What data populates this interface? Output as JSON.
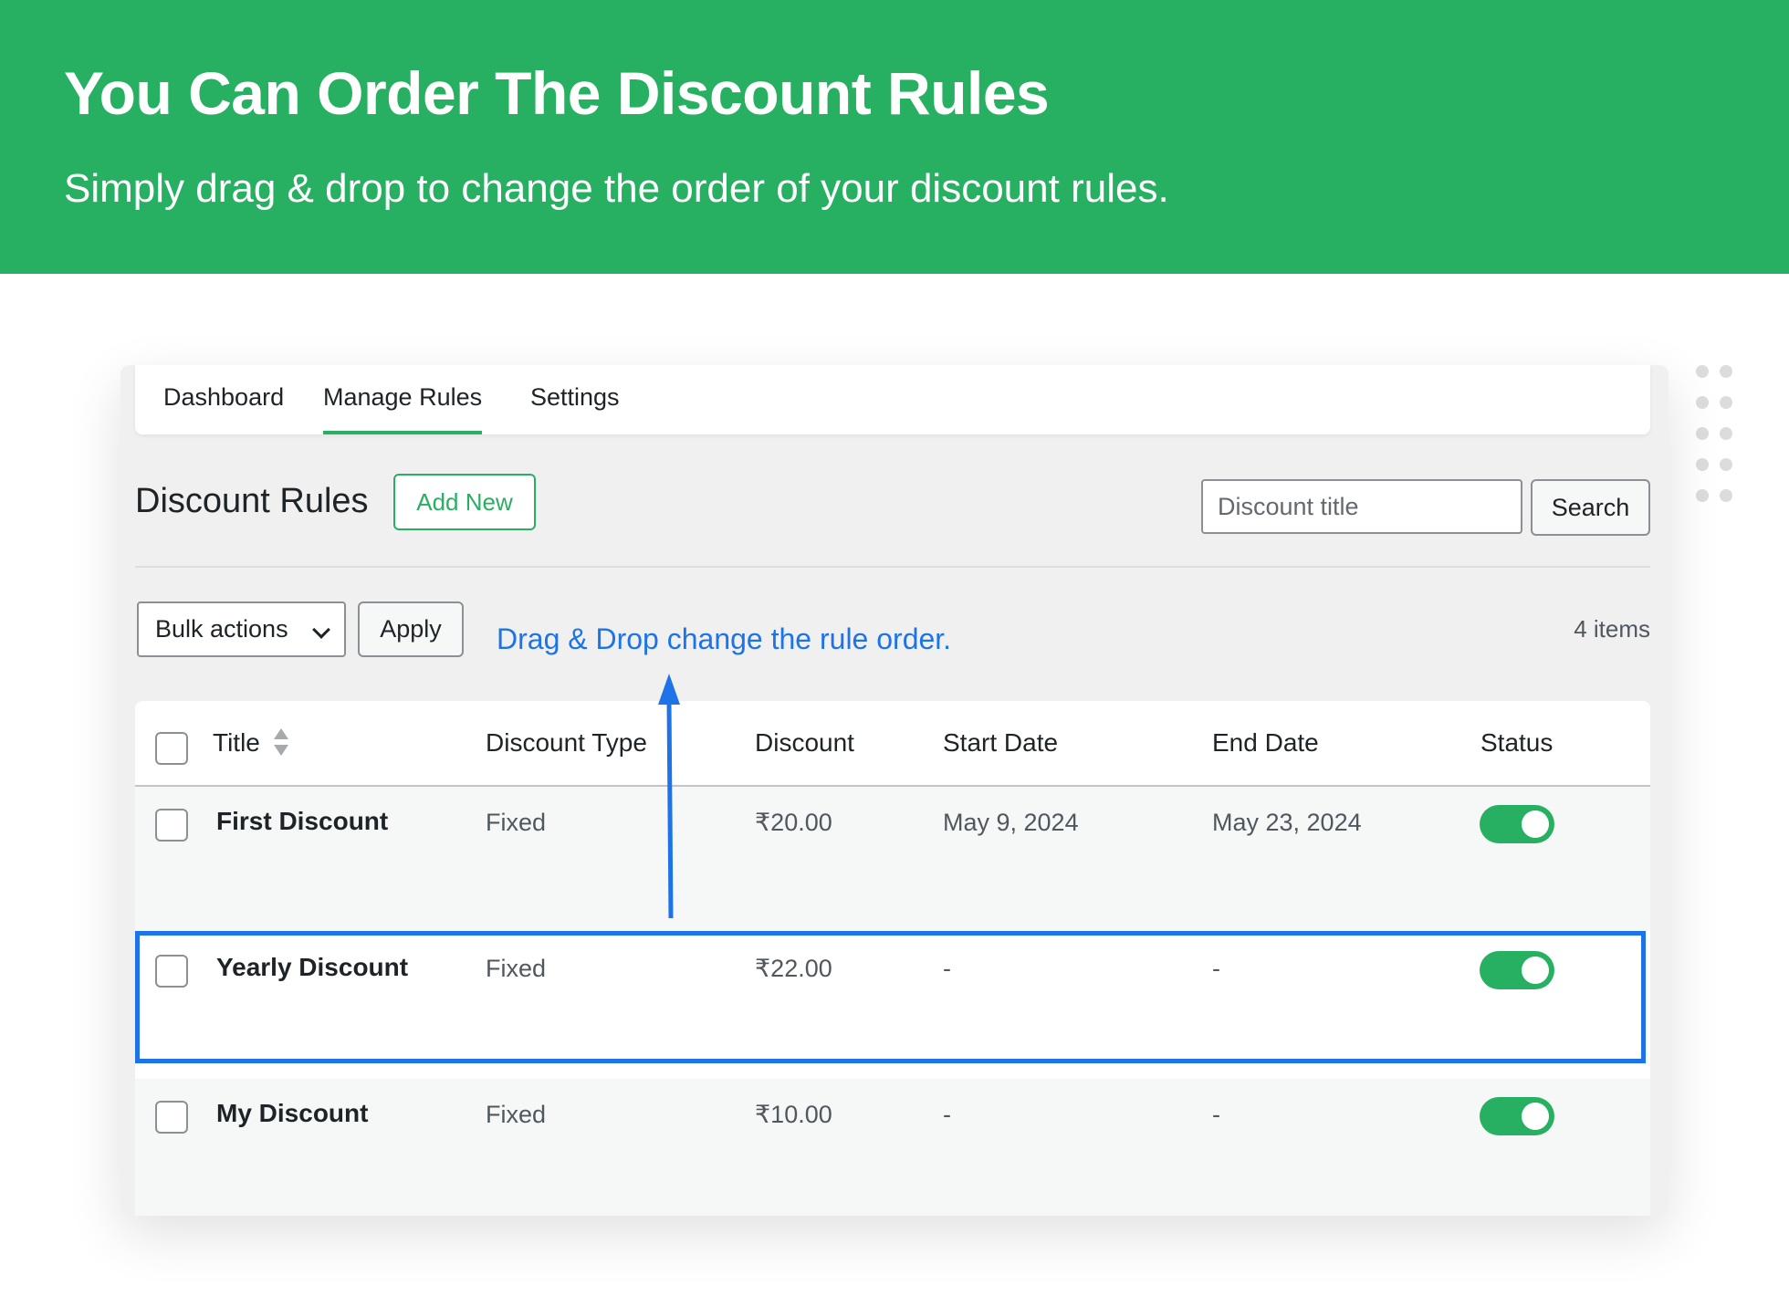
{
  "banner": {
    "title": "You Can Order The Discount Rules",
    "subtitle": "Simply drag & drop to change the order of your discount rules."
  },
  "nav": {
    "tabs": [
      {
        "label": "Dashboard",
        "active": false
      },
      {
        "label": "Manage Rules",
        "active": true
      },
      {
        "label": "Settings",
        "active": false
      }
    ]
  },
  "header": {
    "page_title": "Discount Rules",
    "add_new_label": "Add New",
    "search_placeholder": "Discount title",
    "search_button_label": "Search"
  },
  "toolbar": {
    "bulk_actions_label": "Bulk actions",
    "apply_label": "Apply",
    "hint": "Drag & Drop change the rule order.",
    "items_count": "4 items"
  },
  "table": {
    "columns": [
      "Title",
      "Discount Type",
      "Discount",
      "Start Date",
      "End Date",
      "Status"
    ],
    "rows": [
      {
        "title": "First Discount",
        "type": "Fixed",
        "discount": "₹20.00",
        "start": "May 9, 2024",
        "end": "May 23, 2024",
        "status_on": true
      },
      {
        "title": "Yearly Discount",
        "type": "Fixed",
        "discount": "₹22.00",
        "start": "-",
        "end": "-",
        "status_on": true
      },
      {
        "title": "My Discount",
        "type": "Fixed",
        "discount": "₹10.00",
        "start": "-",
        "end": "-",
        "status_on": true
      }
    ]
  },
  "colors": {
    "brand_green": "#28b062",
    "accent_blue": "#1e73e8"
  }
}
